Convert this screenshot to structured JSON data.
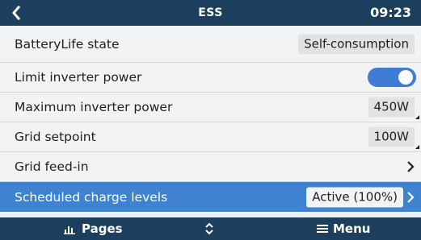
{
  "header": {
    "title": "ESS",
    "time": "09:23",
    "back_icon": "chevron-left-icon"
  },
  "colors": {
    "header_bg": "#1c3f5e",
    "row_bg": "#f1f3f5",
    "selected_row_bg": "#3f83d0",
    "toggle_on": "#3e7bd4"
  },
  "rows": [
    {
      "label": "BatteryLife state",
      "value": "Self-consumption"
    },
    {
      "label": "Limit inverter power",
      "toggle_on": true
    },
    {
      "label": "Maximum inverter power",
      "value": "450W"
    },
    {
      "label": "Grid setpoint",
      "value": "100W"
    },
    {
      "label": "Grid feed-in"
    },
    {
      "label": "Scheduled charge levels",
      "value": "Active (100%)",
      "selected": true
    }
  ],
  "footer": {
    "pages_label": "Pages",
    "menu_label": "Menu",
    "pages_icon": "bar-chart-icon",
    "updown_icon": "up-down-arrows-icon",
    "menu_icon": "hamburger-menu-icon"
  }
}
